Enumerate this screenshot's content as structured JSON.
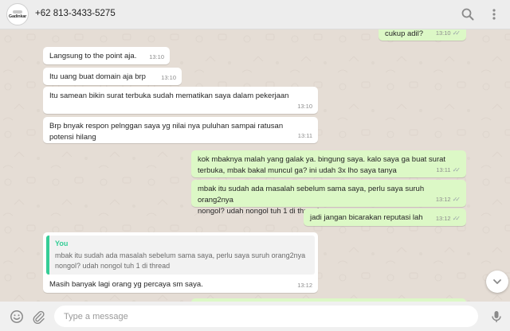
{
  "header": {
    "avatar_text": "Gadinkar",
    "contact_name": "+62 813-3433-5275",
    "icons": [
      "search-icon",
      "menu-icon"
    ]
  },
  "messages": [
    {
      "dir": "out",
      "text": "cukup adil?",
      "time": "13:10",
      "ticks": "✓✓"
    },
    {
      "dir": "in",
      "text": "Langsung to the point aja.",
      "time": "13:10"
    },
    {
      "dir": "in",
      "text": "Itu uang buat domain aja brp",
      "time": "13:10"
    },
    {
      "dir": "in",
      "text": "Itu samean bikin surat terbuka sudah mematikan saya dalam pekerjaan",
      "time": "13:10"
    },
    {
      "dir": "in",
      "text": "Brp bnyak respon pelnggan saya yg nilai nya puluhan sampai ratusan\npotensi hilang",
      "time": "13:11"
    },
    {
      "dir": "out",
      "text": "kok mbaknya malah yang galak ya. bingung saya. kalo saya ga buat surat\nterbuka, mbak bakal muncul ga? ini udah 3x lho saya tanya",
      "time": "13:11",
      "ticks": "✓✓"
    },
    {
      "dir": "out",
      "text": "mbak itu sudah ada masalah sebelum sama saya, perlu saya suruh orang2nya\nnongol? udah nongol tuh 1 di thread",
      "time": "13:12",
      "ticks": "✓✓"
    },
    {
      "dir": "out",
      "text": "jadi jangan bicarakan reputasi lah",
      "time": "13:12",
      "ticks": "✓✓"
    },
    {
      "dir": "in",
      "quote_name": "You",
      "quote_text": "mbak itu sudah ada masalah sebelum sama saya, perlu saya suruh orang2nya\nnongol? udah nongol tuh 1 di thread",
      "text": "Masih banyak lagi orang yg percaya sm saya.",
      "time": "13:12"
    }
  ],
  "composer": {
    "placeholder": "Type a message",
    "icons": [
      "emoji-icon",
      "attach-icon",
      "microphone-icon"
    ]
  },
  "colors": {
    "incoming": "#ffffff",
    "outgoing": "#dcf8c6",
    "quote_accent": "#35cd96",
    "background": "#e5ddd5"
  }
}
